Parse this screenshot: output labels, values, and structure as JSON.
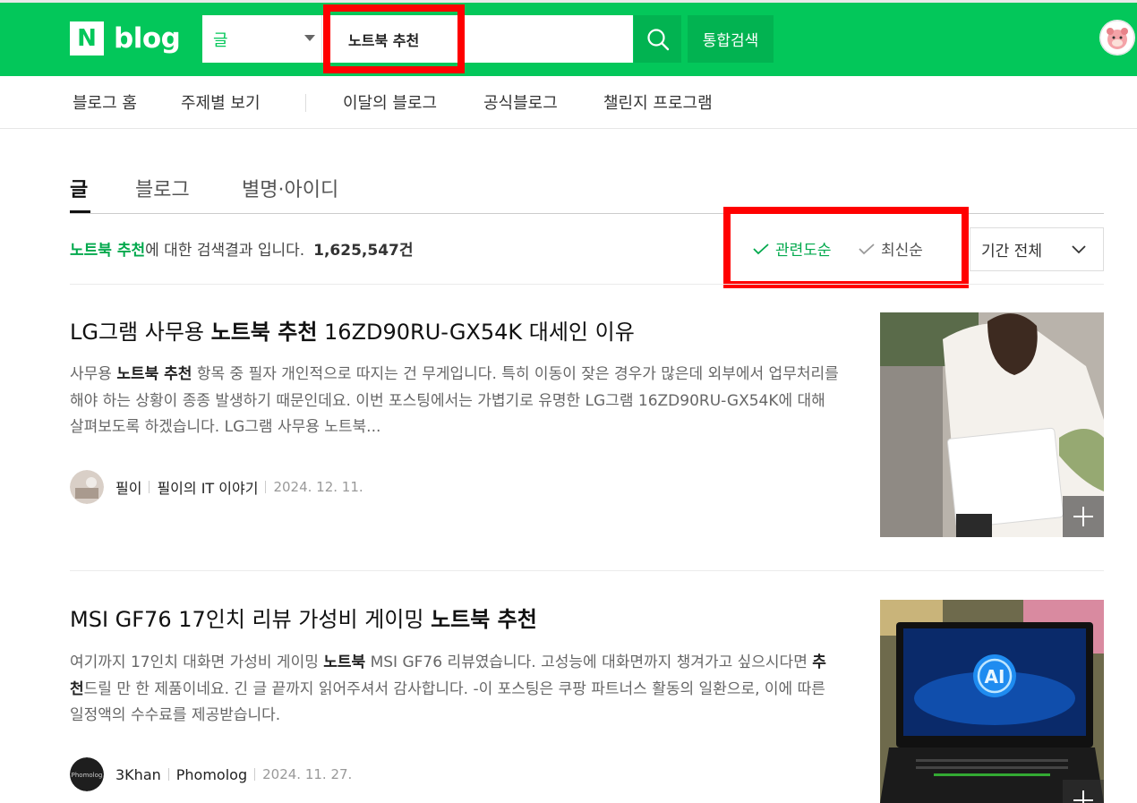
{
  "header": {
    "logo_letter": "N",
    "logo_text": "blog",
    "search_type": "글",
    "search_query": "노트북 추천",
    "total_search_label": "통합검색"
  },
  "gnb": {
    "items": [
      "블로그 홈",
      "주제별 보기",
      "이달의 블로그",
      "공식블로그",
      "챌린지 프로그램"
    ]
  },
  "tabs": [
    "글",
    "블로그",
    "별명·아이디"
  ],
  "result_summary": {
    "keyword": "노트북 추천",
    "suffix": "에 대한 검색결과 입니다.",
    "count": "1,625,547건"
  },
  "sort": {
    "options": [
      "관련도순",
      "최신순"
    ],
    "period": "기간 전체"
  },
  "colors": {
    "brand_green": "#03c75a",
    "highlight_red": "#ff0000"
  },
  "posts": [
    {
      "title_pre": "LG그램 사무용 ",
      "title_kw": "노트북 추천",
      "title_post": " 16ZD90RU-GX54K 대세인 이유",
      "desc_1": "사무용 ",
      "desc_kw1": "노트북 추천",
      "desc_2": " 항목 중 필자 개인적으로 따지는 건 무게입니다. 특히 이동이 잦은 경우가 많은데 외부에서 업무처리를 해야 하는 상황이 종종 발생하기 때문인데요. 이번 포스팅에서는 가볍기로 유명한 LG그램 16ZD90RU-GX54K에 대해 살펴보도록 하겠습니다. LG그램 사무용 노트북...",
      "author": "필이",
      "blog": "필이의 IT 이야기",
      "date": "2024. 12. 11."
    },
    {
      "title_pre": "MSI GF76 17인치 리뷰 가성비 게이밍 ",
      "title_kw": "노트북 추천",
      "title_post": "",
      "desc_1": "여기까지 17인치 대화면 가성비 게이밍 ",
      "desc_kw1": "노트북",
      "desc_2": " MSI GF76 리뷰였습니다. 고성능에 대화면까지 챙겨가고 싶으시다면 ",
      "desc_kw2": "추천",
      "desc_3": "드릴 만 한 제품이네요. 긴 글 끝까지 읽어주셔서 감사합니다. -이 포스팅은 쿠팡 파트너스 활동의 일환으로, 이에 따른 일정액의 수수료를 제공받습니다.",
      "author": "3Khan",
      "blog": "Phomolog",
      "date": "2024. 11. 27.",
      "avatar_text": "Phomolog",
      "thumb_badge": "AI"
    }
  ]
}
